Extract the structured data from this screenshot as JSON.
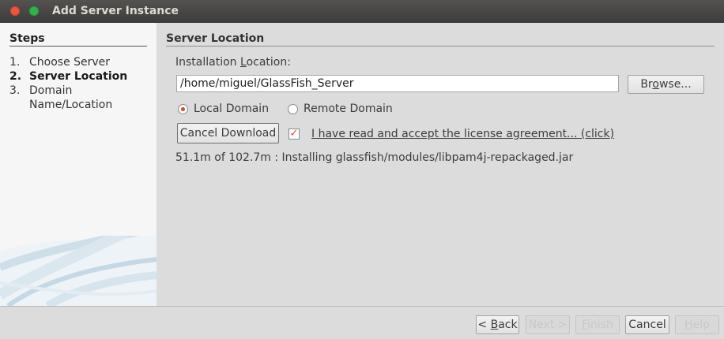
{
  "window": {
    "title": "Add Server Instance"
  },
  "steps": {
    "heading": "Steps",
    "items": [
      {
        "num": "1.",
        "label": "Choose Server"
      },
      {
        "num": "2.",
        "label": "Server Location"
      },
      {
        "num": "3.",
        "label": "Domain",
        "label2": "Name/Location"
      }
    ]
  },
  "main": {
    "title": "Server Location",
    "install_label_pre": "Installation ",
    "install_label_u": "L",
    "install_label_post": "ocation:",
    "install_path": "/home/miguel/GlassFish_Server",
    "browse_pre": "Br",
    "browse_u": "o",
    "browse_post": "wse...",
    "radio_local": "Local Domain",
    "radio_remote": "Remote Domain",
    "cancel_download": "Cancel Download",
    "license_link": "I have read and accept the license agreement... (click)",
    "status": "51.1m of 102.7m : Installing glassfish/modules/libpam4j-repackaged.jar"
  },
  "footer": {
    "back_u": "B",
    "back_post": "ack",
    "back_pre": "< ",
    "next": "Next >",
    "finish_u": "F",
    "finish_post": "inish",
    "cancel": "Cancel",
    "help_u": "H",
    "help_post": "elp"
  }
}
